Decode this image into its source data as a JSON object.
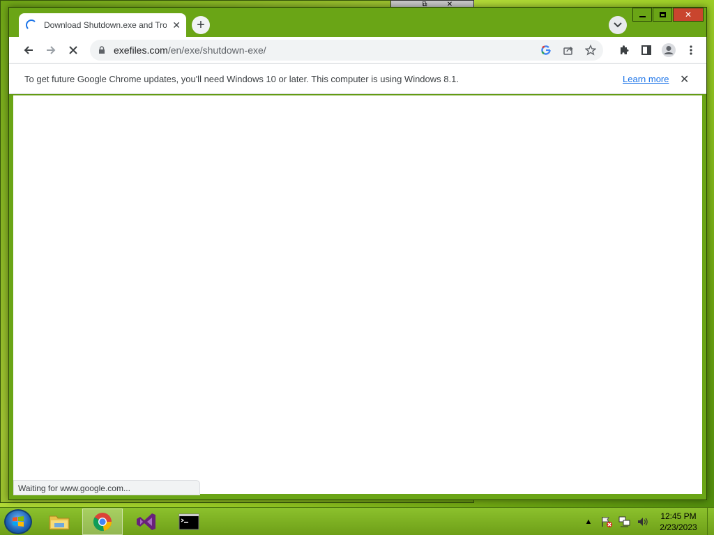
{
  "browser": {
    "tab": {
      "title": "Download Shutdown.exe and Troubleshoot"
    },
    "omnibox": {
      "host": "exefiles.com",
      "path": "/en/exe/shutdown-exe/"
    },
    "infobar": {
      "message": "To get future Google Chrome updates, you'll need Windows 10 or later. This computer is using Windows 8.1.",
      "learn_more": "Learn more"
    },
    "status": "Waiting for www.google.com..."
  },
  "taskbar": {
    "clock": {
      "time": "12:45 PM",
      "date": "2/23/2023"
    }
  },
  "colors": {
    "chrome_blue": "#1a73e8",
    "window_frame": "#6aa516",
    "close_red": "#c9452e"
  }
}
